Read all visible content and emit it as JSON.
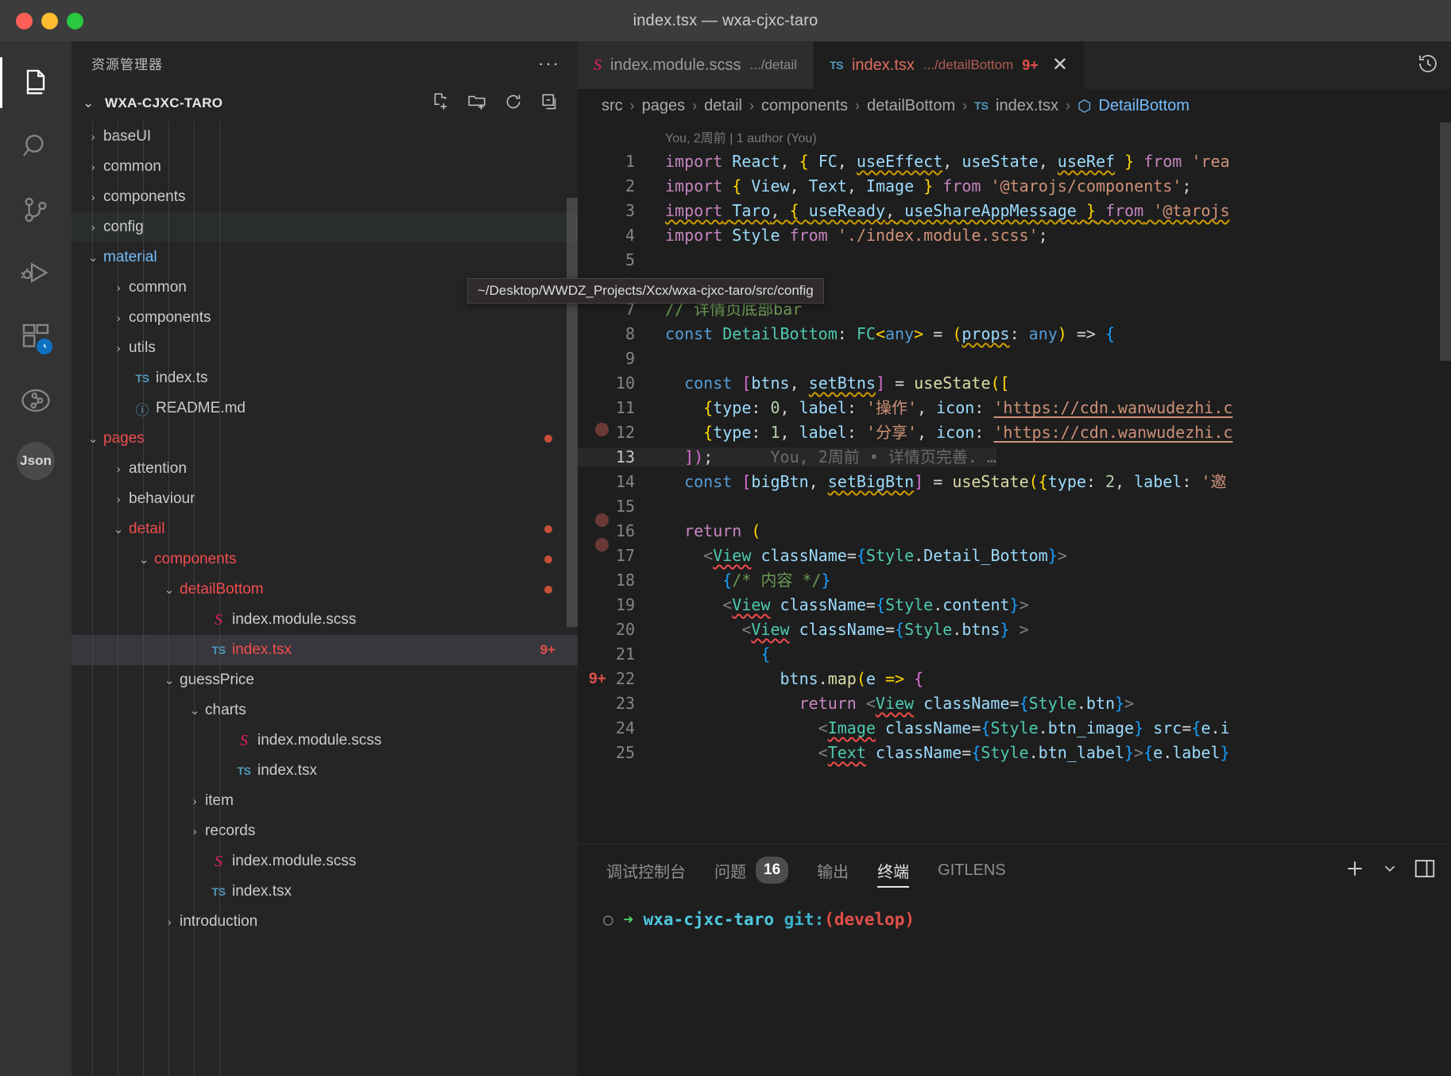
{
  "window": {
    "title": "index.tsx — wxa-cjxc-taro",
    "traffic": [
      "close",
      "minimize",
      "zoom"
    ]
  },
  "activity_bar": {
    "items": [
      {
        "name": "explorer",
        "icon": "files-icon",
        "active": true
      },
      {
        "name": "search",
        "icon": "search-icon",
        "active": false
      },
      {
        "name": "source-control",
        "icon": "source-control-icon",
        "active": false
      },
      {
        "name": "run-and-debug",
        "icon": "debug-icon",
        "active": false
      },
      {
        "name": "extensions",
        "icon": "extensions-icon",
        "active": false,
        "badge": "clock"
      },
      {
        "name": "gitlens",
        "icon": "gitlens-icon",
        "active": false
      }
    ],
    "avatar_label": "Json"
  },
  "sidebar": {
    "title": "资源管理器",
    "more_label": "···",
    "root": {
      "label": "WXA-CJXC-TARO",
      "chevron": "⌄",
      "actions": [
        "new-file-icon",
        "new-folder-icon",
        "refresh-icon",
        "collapse-all-icon"
      ]
    },
    "tree": [
      {
        "label": "baseUI",
        "indent": 1,
        "chevron": "closed",
        "type": "folder",
        "color": "default"
      },
      {
        "label": "common",
        "indent": 1,
        "chevron": "closed",
        "type": "folder",
        "color": "default"
      },
      {
        "label": "components",
        "indent": 1,
        "chevron": "closed",
        "type": "folder",
        "color": "default"
      },
      {
        "label": "config",
        "indent": 1,
        "chevron": "closed",
        "type": "folder",
        "color": "default",
        "state": "hover"
      },
      {
        "label": "material",
        "indent": 1,
        "chevron": "open",
        "type": "folder",
        "color": "blue"
      },
      {
        "label": "common",
        "indent": 2,
        "chevron": "closed",
        "type": "folder",
        "color": "default"
      },
      {
        "label": "components",
        "indent": 2,
        "chevron": "closed",
        "type": "folder",
        "color": "default"
      },
      {
        "label": "utils",
        "indent": 2,
        "chevron": "closed",
        "type": "folder",
        "color": "default"
      },
      {
        "label": "index.ts",
        "indent": 2,
        "chevron": "none",
        "type": "ts",
        "color": "default"
      },
      {
        "label": "README.md",
        "indent": 2,
        "chevron": "none",
        "type": "md",
        "color": "default"
      },
      {
        "label": "pages",
        "indent": 1,
        "chevron": "open",
        "type": "folder",
        "color": "git-red",
        "dot": true
      },
      {
        "label": "attention",
        "indent": 2,
        "chevron": "closed",
        "type": "folder",
        "color": "default"
      },
      {
        "label": "behaviour",
        "indent": 2,
        "chevron": "closed",
        "type": "folder",
        "color": "default"
      },
      {
        "label": "detail",
        "indent": 2,
        "chevron": "open",
        "type": "folder",
        "color": "git-red",
        "dot": true
      },
      {
        "label": "components",
        "indent": 3,
        "chevron": "open",
        "type": "folder",
        "color": "git-red",
        "dot": true
      },
      {
        "label": "detailBottom",
        "indent": 4,
        "chevron": "open",
        "type": "folder",
        "color": "git-red",
        "dot": true
      },
      {
        "label": "index.module.scss",
        "indent": 5,
        "chevron": "none",
        "type": "scss",
        "color": "default"
      },
      {
        "label": "index.tsx",
        "indent": 5,
        "chevron": "none",
        "type": "ts",
        "color": "git-red",
        "state": "selected",
        "count": "9+"
      },
      {
        "label": "guessPrice",
        "indent": 4,
        "chevron": "open",
        "type": "folder",
        "color": "default"
      },
      {
        "label": "charts",
        "indent": 5,
        "chevron": "open",
        "type": "folder",
        "color": "default"
      },
      {
        "label": "index.module.scss",
        "indent": 6,
        "chevron": "none",
        "type": "scss",
        "color": "default"
      },
      {
        "label": "index.tsx",
        "indent": 6,
        "chevron": "none",
        "type": "ts",
        "color": "default"
      },
      {
        "label": "item",
        "indent": 5,
        "chevron": "closed",
        "type": "folder",
        "color": "default"
      },
      {
        "label": "records",
        "indent": 5,
        "chevron": "closed",
        "type": "folder",
        "color": "default"
      },
      {
        "label": "index.module.scss",
        "indent": 5,
        "chevron": "none",
        "type": "scss",
        "color": "default"
      },
      {
        "label": "index.tsx",
        "indent": 5,
        "chevron": "none",
        "type": "ts",
        "color": "default"
      },
      {
        "label": "introduction",
        "indent": 4,
        "chevron": "closed",
        "type": "folder",
        "color": "default"
      }
    ]
  },
  "tooltip": {
    "text": "~/Desktop/WWDZ_Projects/Xcx/wxa-cjxc-taro/src/config"
  },
  "editor": {
    "tabs": [
      {
        "name": "index.module.scss",
        "path": ".../detail",
        "icon": "scss-icon",
        "active": false
      },
      {
        "name": "index.tsx",
        "path": ".../detailBottom",
        "icon": "ts-icon",
        "active": true,
        "badge": "9+",
        "close": "✕"
      }
    ],
    "tab_actions": [
      "history-icon"
    ],
    "breadcrumb": [
      "src",
      "pages",
      "detail",
      "components",
      "detailBottom",
      "index.tsx",
      "DetailBottom"
    ],
    "breadcrumb_sep": "›",
    "blame_header": "You, 2周前 | 1 author (You)",
    "inline_blame": "You, 2周前 • 详情页完善. …",
    "current_line": 13,
    "lines": [
      {
        "n": 1,
        "text": "import React, { FC, useEffect, useState, useRef } from 'rea"
      },
      {
        "n": 2,
        "text": "import { View, Text, Image } from '@tarojs/components';"
      },
      {
        "n": 3,
        "text": "import Taro, { useReady, useShareAppMessage } from '@tarojs"
      },
      {
        "n": 4,
        "text": "import Style from './index.module.scss';"
      },
      {
        "n": 5,
        "text": ""
      },
      {
        "n": 6,
        "text": ""
      },
      {
        "n": 7,
        "text": "// 详情页底部bar"
      },
      {
        "n": 8,
        "text": "const DetailBottom: FC<any> = (props: any) => {"
      },
      {
        "n": 9,
        "text": ""
      },
      {
        "n": 10,
        "text": "  const [btns, setBtns] = useState(["
      },
      {
        "n": 11,
        "text": "    {type: 0, label: '操作', icon: 'https://cdn.wanwudezhi.c"
      },
      {
        "n": 12,
        "text": "    {type: 1, label: '分享', icon: 'https://cdn.wanwudezhi.c"
      },
      {
        "n": 13,
        "text": "  ]);"
      },
      {
        "n": 14,
        "text": "  const [bigBtn, setBigBtn] = useState({type: 2, label: '邀"
      },
      {
        "n": 15,
        "text": ""
      },
      {
        "n": 16,
        "text": "  return ("
      },
      {
        "n": 17,
        "text": "    <View className={Style.Detail_Bottom}>"
      },
      {
        "n": 18,
        "text": "      {/* 内容 */}"
      },
      {
        "n": 19,
        "text": "      <View className={Style.content}>"
      },
      {
        "n": 20,
        "text": "        <View className={Style.btns} >"
      },
      {
        "n": 21,
        "text": "          {"
      },
      {
        "n": 22,
        "text": "            btns.map(e => {"
      },
      {
        "n": 23,
        "text": "              return <View className={Style.btn}>"
      },
      {
        "n": 24,
        "text": "                <Image className={Style.btn_image} src={e.i"
      },
      {
        "n": 25,
        "text": "                <Text className={Style.btn_label}>{e.label}"
      }
    ]
  },
  "panel": {
    "tabs": [
      {
        "label": "调试控制台",
        "active": false
      },
      {
        "label": "问题",
        "active": false,
        "count": "16"
      },
      {
        "label": "输出",
        "active": false
      },
      {
        "label": "终端",
        "active": true
      },
      {
        "label": "GITLENS",
        "active": false
      }
    ],
    "actions": [
      "add-terminal-icon",
      "chevron-down-icon",
      "split-panel-icon"
    ],
    "terminal": {
      "circle": "○",
      "arrow": "➜",
      "dir": "wxa-cjxc-taro",
      "git_label": "git:",
      "branch": "(develop)"
    }
  }
}
